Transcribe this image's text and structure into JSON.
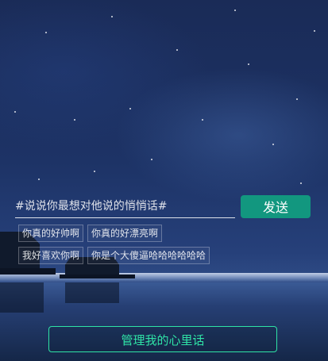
{
  "wish_input": {
    "placeholder": "#说说你最想对他说的悄悄话#"
  },
  "send_button": {
    "label": "发送"
  },
  "quick_tags": [
    [
      "你真的好帅啊",
      "你真的好漂亮啊"
    ],
    [
      "我好喜欢你啊",
      "你是个大傻逼哈哈哈哈哈哈"
    ]
  ],
  "manage_button": {
    "label": "管理我的心里话"
  },
  "colors": {
    "send_button_bg": "#12977f",
    "manage_button_accent": "#2fe3a6",
    "sky": "#1b2d5c"
  }
}
